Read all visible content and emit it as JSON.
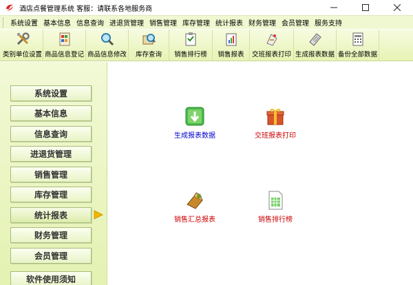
{
  "window": {
    "title": "酒店点餐管理系统 客服：请联系各地服务商",
    "controls": [
      "minimize",
      "maximize",
      "close"
    ],
    "icons": {
      "app": "app-logo-icon"
    }
  },
  "menu": {
    "items": [
      "系统设置",
      "基本信息",
      "信息查询",
      "进退货管理",
      "销售管理",
      "库存管理",
      "统计报表",
      "财务管理",
      "会员管理",
      "服务支持"
    ]
  },
  "toolbar": {
    "buttons": [
      {
        "label": "类别单位设置",
        "icon": "tools-icon"
      },
      {
        "label": "商品信息登记",
        "icon": "product-register-icon"
      },
      {
        "label": "商品信息修改",
        "icon": "magnifier-edit-icon"
      },
      {
        "label": "库存查询",
        "icon": "inventory-search-icon"
      },
      {
        "label": "销售排行榜",
        "icon": "clipboard-icon"
      },
      {
        "label": "销售报表",
        "icon": "report-icon"
      },
      {
        "label": "交班报表打印",
        "icon": "print-icon"
      },
      {
        "label": "生成报表数据",
        "icon": "calculator-icon"
      },
      {
        "label": "备份全部数据",
        "icon": "backup-icon"
      }
    ]
  },
  "sidebar": {
    "items": [
      "系统设置",
      "基本信息",
      "信息查询",
      "进退货管理",
      "销售管理",
      "库存管理",
      "统计报表",
      "财务管理",
      "会员管理",
      "软件使用须知"
    ],
    "active": "统计报表"
  },
  "main": {
    "tiles": [
      {
        "label": "生成报表数据",
        "icon": "download-icon",
        "color": "#0000cc"
      },
      {
        "label": "交班报表打印",
        "icon": "gift-box-icon",
        "color": "#cc0000"
      },
      {
        "label": "销售汇总报表",
        "icon": "sales-summary-icon",
        "color": "#cc0000"
      },
      {
        "label": "销售排行榜",
        "icon": "spreadsheet-icon",
        "color": "#cc0000"
      }
    ]
  },
  "colors": {
    "accent": "#e6f3b4",
    "arrow": "#f2b600"
  }
}
